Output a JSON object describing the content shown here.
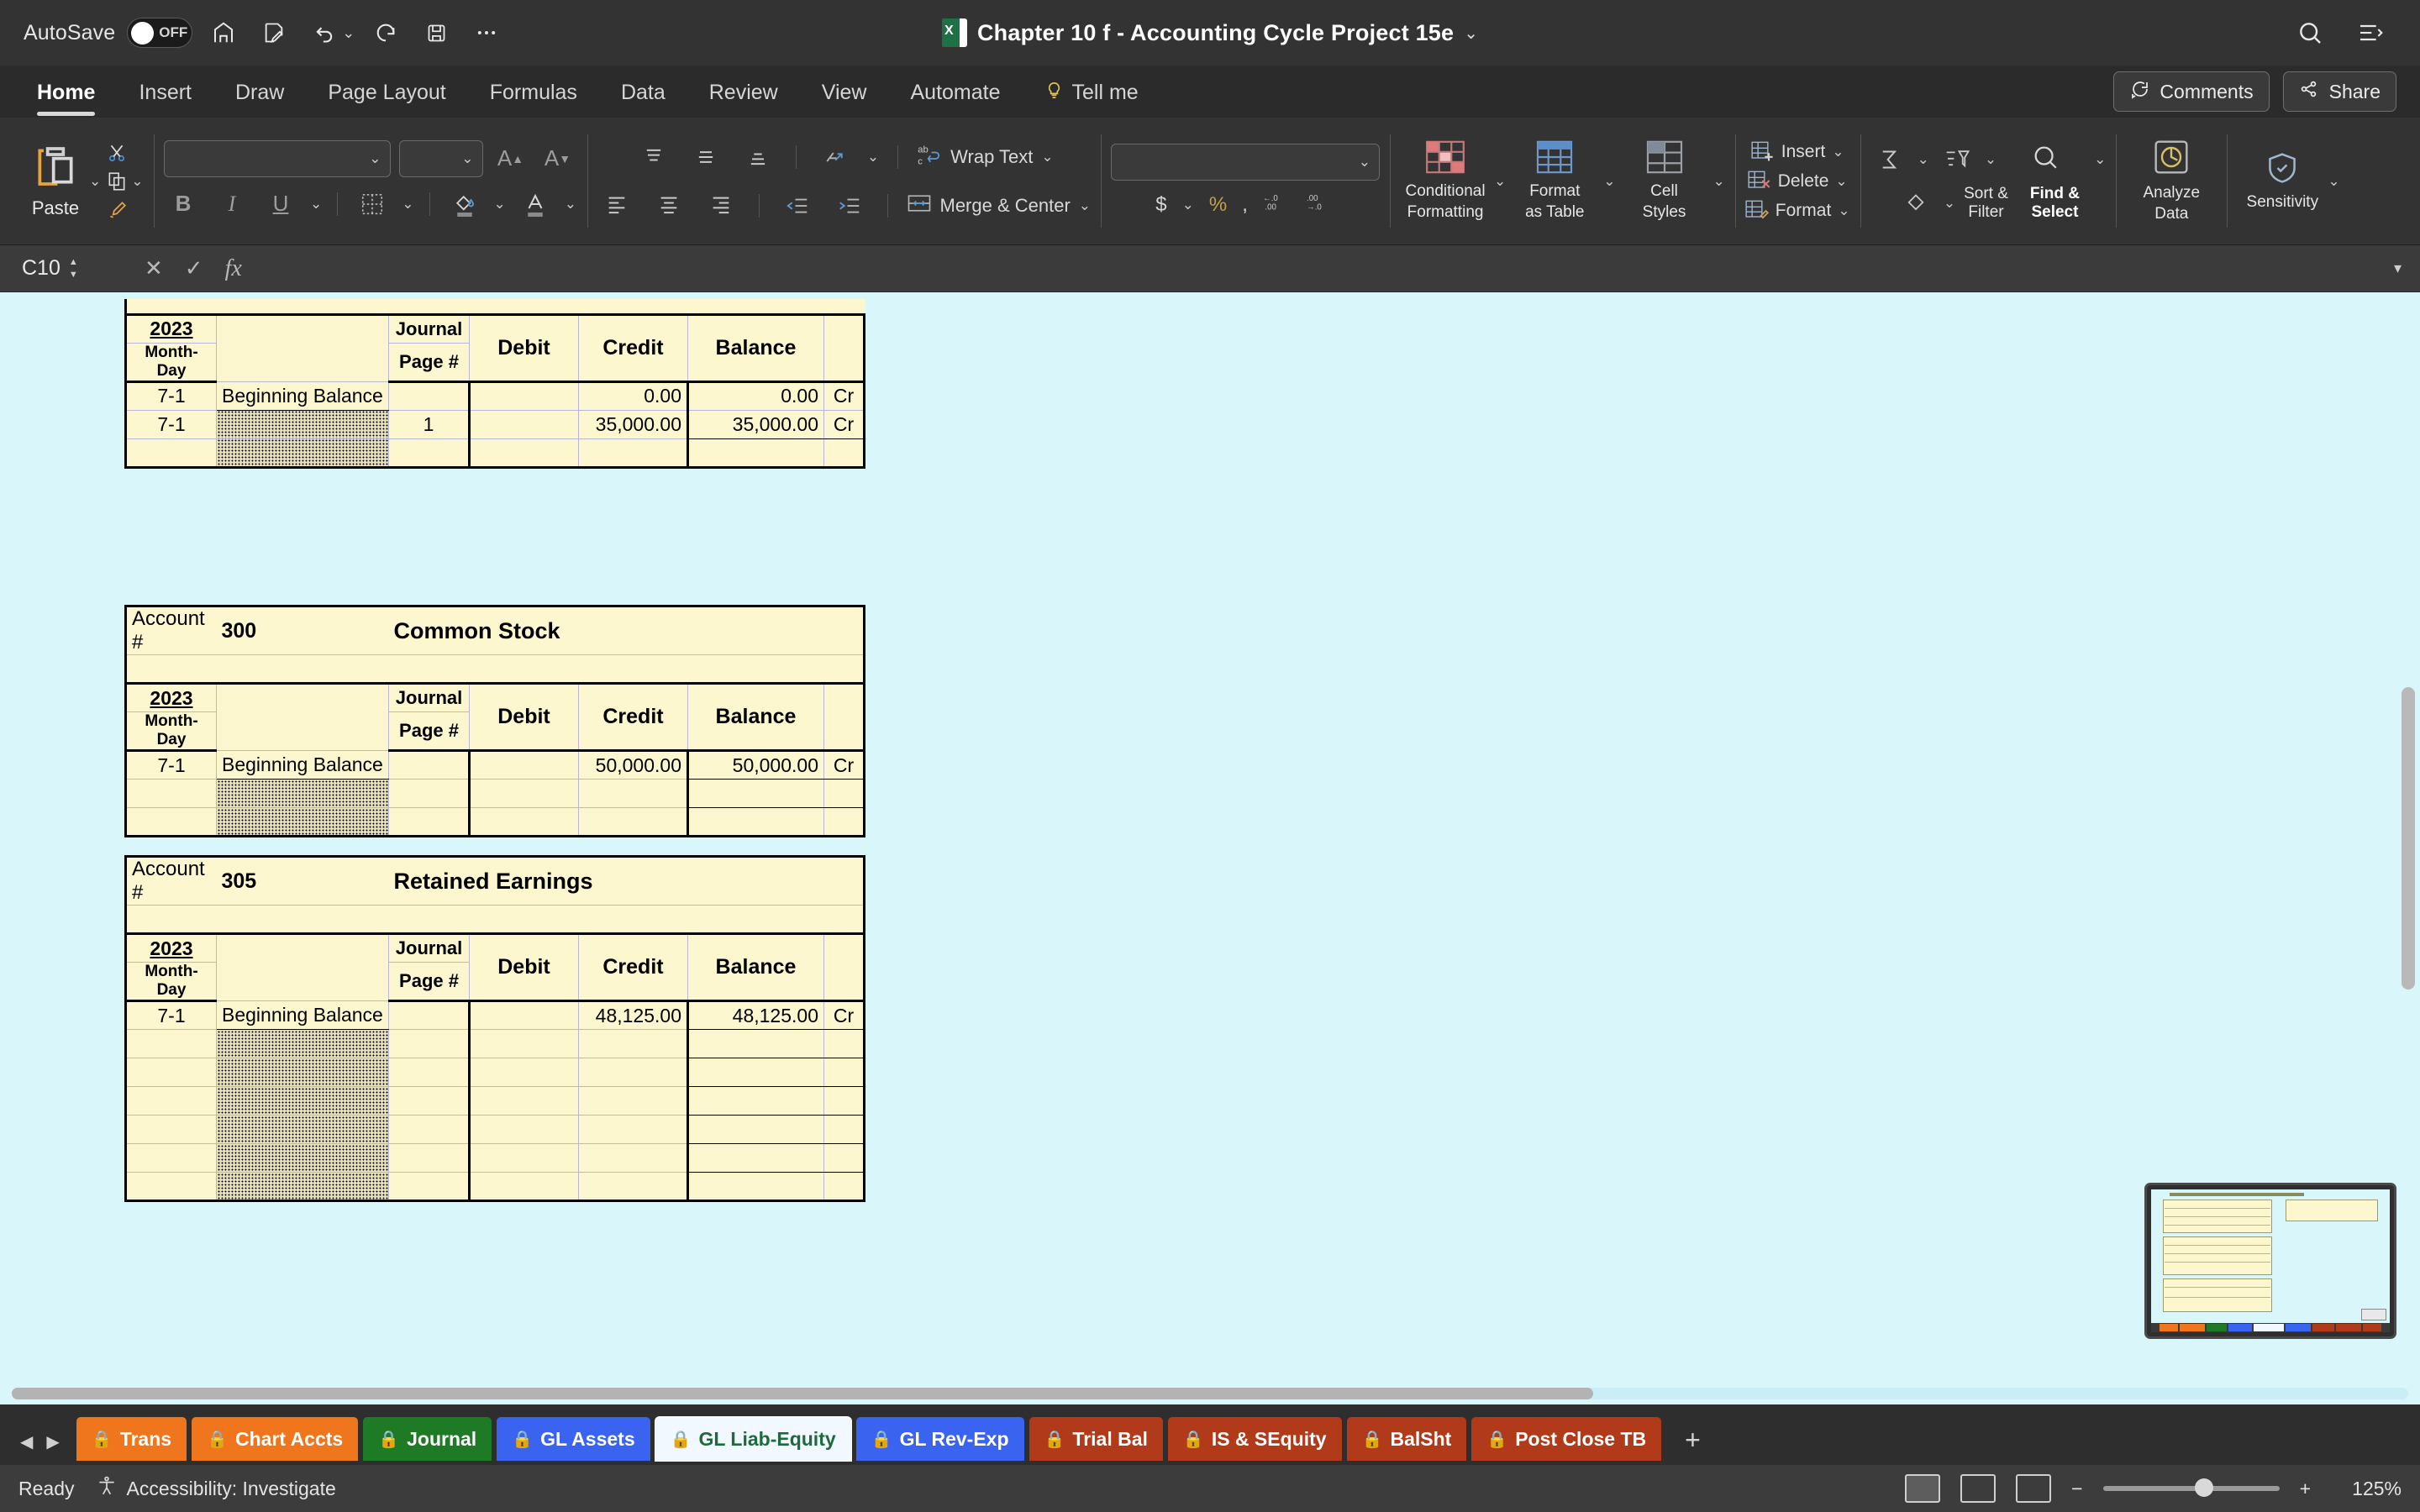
{
  "titlebar": {
    "autosave_label": "AutoSave",
    "autosave_state": "OFF",
    "document_title": "Chapter 10 f - Accounting Cycle Project 15e",
    "icons": [
      "home-icon",
      "save-as-icon",
      "undo-icon",
      "redo-icon",
      "save-icon",
      "more-icon",
      "search-icon",
      "ribbon-display-icon"
    ]
  },
  "ribbon_tabs": {
    "items": [
      {
        "label": "Home",
        "active": true
      },
      {
        "label": "Insert",
        "active": false
      },
      {
        "label": "Draw",
        "active": false
      },
      {
        "label": "Page Layout",
        "active": false
      },
      {
        "label": "Formulas",
        "active": false
      },
      {
        "label": "Data",
        "active": false
      },
      {
        "label": "Review",
        "active": false
      },
      {
        "label": "View",
        "active": false
      },
      {
        "label": "Automate",
        "active": false
      },
      {
        "label": "Tell me",
        "active": false
      }
    ],
    "comments_label": "Comments",
    "share_label": "Share"
  },
  "ribbon": {
    "paste_label": "Paste",
    "font_name": "",
    "font_size": "",
    "number_format": "",
    "wrap_text_label": "Wrap Text",
    "merge_center_label": "Merge & Center",
    "conditional_formatting_label": "Conditional\nFormatting",
    "conditional_formatting_line1": "Conditional",
    "conditional_formatting_line2": "Formatting",
    "format_as_table_line1": "Format",
    "format_as_table_line2": "as Table",
    "cell_styles_line1": "Cell",
    "cell_styles_line2": "Styles",
    "insert_label": "Insert",
    "delete_label": "Delete",
    "format_label": "Format",
    "sort_filter_line1": "Sort &",
    "sort_filter_line2": "Filter",
    "find_select_line1": "Find &",
    "find_select_line2": "Select",
    "analyze_data_line1": "Analyze",
    "analyze_data_line2": "Data",
    "sensitivity_label": "Sensitivity"
  },
  "formula_bar": {
    "name_box": "C10",
    "formula_value": ""
  },
  "spreadsheet": {
    "column_headers": {
      "year": "2023",
      "month_day": "Month-Day",
      "journal_line1": "Journal",
      "journal_line2": "Page #",
      "debit": "Debit",
      "credit": "Credit",
      "balance": "Balance"
    },
    "account_label": "Account #",
    "ledgers": [
      {
        "id": "ledger-partial-top",
        "account_number": "",
        "account_name": "",
        "partial": true,
        "rows": [
          {
            "date": "7-1",
            "description": "Beginning Balance",
            "journal_page": "",
            "debit": "",
            "credit": "0.00",
            "balance": "0.00",
            "dc": "Cr",
            "hatched": false
          },
          {
            "date": "7-1",
            "description": "",
            "journal_page": "1",
            "debit": "",
            "credit": "35,000.00",
            "balance": "35,000.00",
            "dc": "Cr",
            "hatched": true
          },
          {
            "date": "",
            "description": "",
            "journal_page": "",
            "debit": "",
            "credit": "",
            "balance": "",
            "dc": "",
            "hatched": true
          }
        ]
      },
      {
        "id": "ledger-common-stock",
        "account_number": "300",
        "account_name": "Common Stock",
        "partial": false,
        "rows": [
          {
            "date": "7-1",
            "description": "Beginning Balance",
            "journal_page": "",
            "debit": "",
            "credit": "50,000.00",
            "balance": "50,000.00",
            "dc": "Cr",
            "hatched": false
          },
          {
            "date": "",
            "description": "",
            "journal_page": "",
            "debit": "",
            "credit": "",
            "balance": "",
            "dc": "",
            "hatched": true
          },
          {
            "date": "",
            "description": "",
            "journal_page": "",
            "debit": "",
            "credit": "",
            "balance": "",
            "dc": "",
            "hatched": true
          }
        ]
      },
      {
        "id": "ledger-retained-earnings",
        "account_number": "305",
        "account_name": "Retained Earnings",
        "partial": false,
        "rows": [
          {
            "date": "7-1",
            "description": "Beginning Balance",
            "journal_page": "",
            "debit": "",
            "credit": "48,125.00",
            "balance": "48,125.00",
            "dc": "Cr",
            "hatched": false
          },
          {
            "date": "",
            "description": "",
            "journal_page": "",
            "debit": "",
            "credit": "",
            "balance": "",
            "dc": "",
            "hatched": true
          },
          {
            "date": "",
            "description": "",
            "journal_page": "",
            "debit": "",
            "credit": "",
            "balance": "",
            "dc": "",
            "hatched": true
          },
          {
            "date": "",
            "description": "",
            "journal_page": "",
            "debit": "",
            "credit": "",
            "balance": "",
            "dc": "",
            "hatched": true
          },
          {
            "date": "",
            "description": "",
            "journal_page": "",
            "debit": "",
            "credit": "",
            "balance": "",
            "dc": "",
            "hatched": true
          },
          {
            "date": "",
            "description": "",
            "journal_page": "",
            "debit": "",
            "credit": "",
            "balance": "",
            "dc": "",
            "hatched": true
          },
          {
            "date": "",
            "description": "",
            "journal_page": "",
            "debit": "",
            "credit": "",
            "balance": "",
            "dc": "",
            "hatched": true
          }
        ]
      }
    ]
  },
  "sheet_tabs": {
    "items": [
      {
        "label": "Trans",
        "color": "#f0761e",
        "text_color": "#ffffff",
        "active": false
      },
      {
        "label": "Chart Accts",
        "color": "#f0761e",
        "text_color": "#ffffff",
        "active": false
      },
      {
        "label": "Journal",
        "color": "#1f7a26",
        "text_color": "#ffffff",
        "active": false
      },
      {
        "label": "GL Assets",
        "color": "#3a63f0",
        "text_color": "#ffffff",
        "active": false
      },
      {
        "label": "GL Liab-Equity",
        "color": "#f2f8ff",
        "text_color": "#1e6b3a",
        "active": true
      },
      {
        "label": "GL Rev-Exp",
        "color": "#3a63f0",
        "text_color": "#ffffff",
        "active": false
      },
      {
        "label": "Trial Bal",
        "color": "#b03a1a",
        "text_color": "#ffffff",
        "active": false
      },
      {
        "label": "IS & SEquity",
        "color": "#b03a1a",
        "text_color": "#ffffff",
        "active": false
      },
      {
        "label": "BalSht",
        "color": "#b03a1a",
        "text_color": "#ffffff",
        "active": false
      },
      {
        "label": "Post Close TB",
        "color": "#b03a1a",
        "text_color": "#ffffff",
        "active": false
      }
    ],
    "add_sheet_label": "+"
  },
  "status_bar": {
    "ready_label": "Ready",
    "accessibility_label": "Accessibility: Investigate",
    "zoom_level": "125%",
    "zoom_out_label": "−",
    "zoom_in_label": "+"
  }
}
